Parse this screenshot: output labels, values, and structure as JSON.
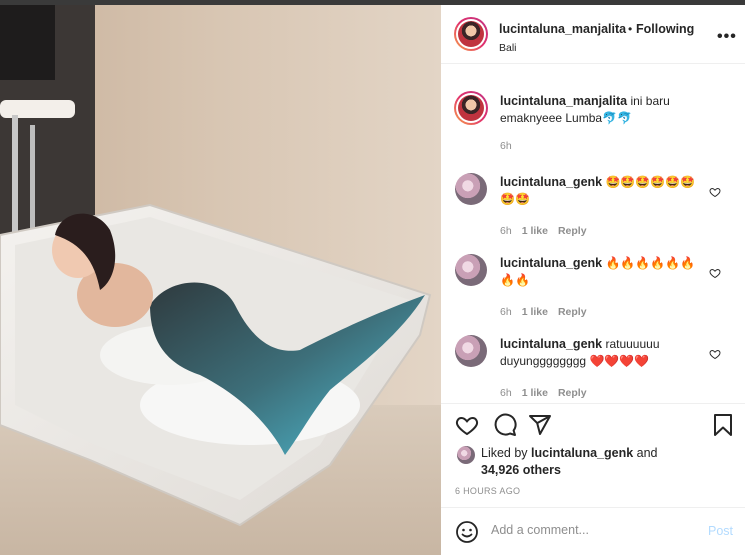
{
  "post": {
    "username": "lucintaluna_manjalita",
    "separator": "•",
    "follow_status": "Following",
    "location": "Bali",
    "more_label": "•••"
  },
  "caption": {
    "username": "lucintaluna_manjalita",
    "text": "ini baru emaknyeee Lumba",
    "emoji": "🐬🐬",
    "time": "6h"
  },
  "comments": [
    {
      "username": "lucintaluna_genk",
      "text": "",
      "emoji": "🤩🤩🤩🤩🤩🤩🤩🤩",
      "time": "6h",
      "likes": "1 like",
      "reply": "Reply"
    },
    {
      "username": "lucintaluna_genk",
      "text": "",
      "emoji": "🔥🔥🔥🔥🔥🔥🔥🔥",
      "time": "6h",
      "likes": "1 like",
      "reply": "Reply"
    },
    {
      "username": "lucintaluna_genk",
      "text": "ratuuuuuu duyungggggggg",
      "emoji": "❤️❤️❤️❤️",
      "time": "6h",
      "likes": "1 like",
      "reply": "Reply"
    }
  ],
  "likes": {
    "prefix": "Liked by",
    "user": "lucintaluna_genk",
    "middle": "and",
    "count": "34,926 others"
  },
  "posted_ago": "6 HOURS AGO",
  "add_comment": {
    "placeholder": "Add a comment...",
    "post_label": "Post"
  },
  "icons": {
    "like": "heart-icon",
    "comment": "comment-icon",
    "share": "paper-plane-icon",
    "save": "bookmark-icon",
    "emoji": "smiley-icon"
  }
}
